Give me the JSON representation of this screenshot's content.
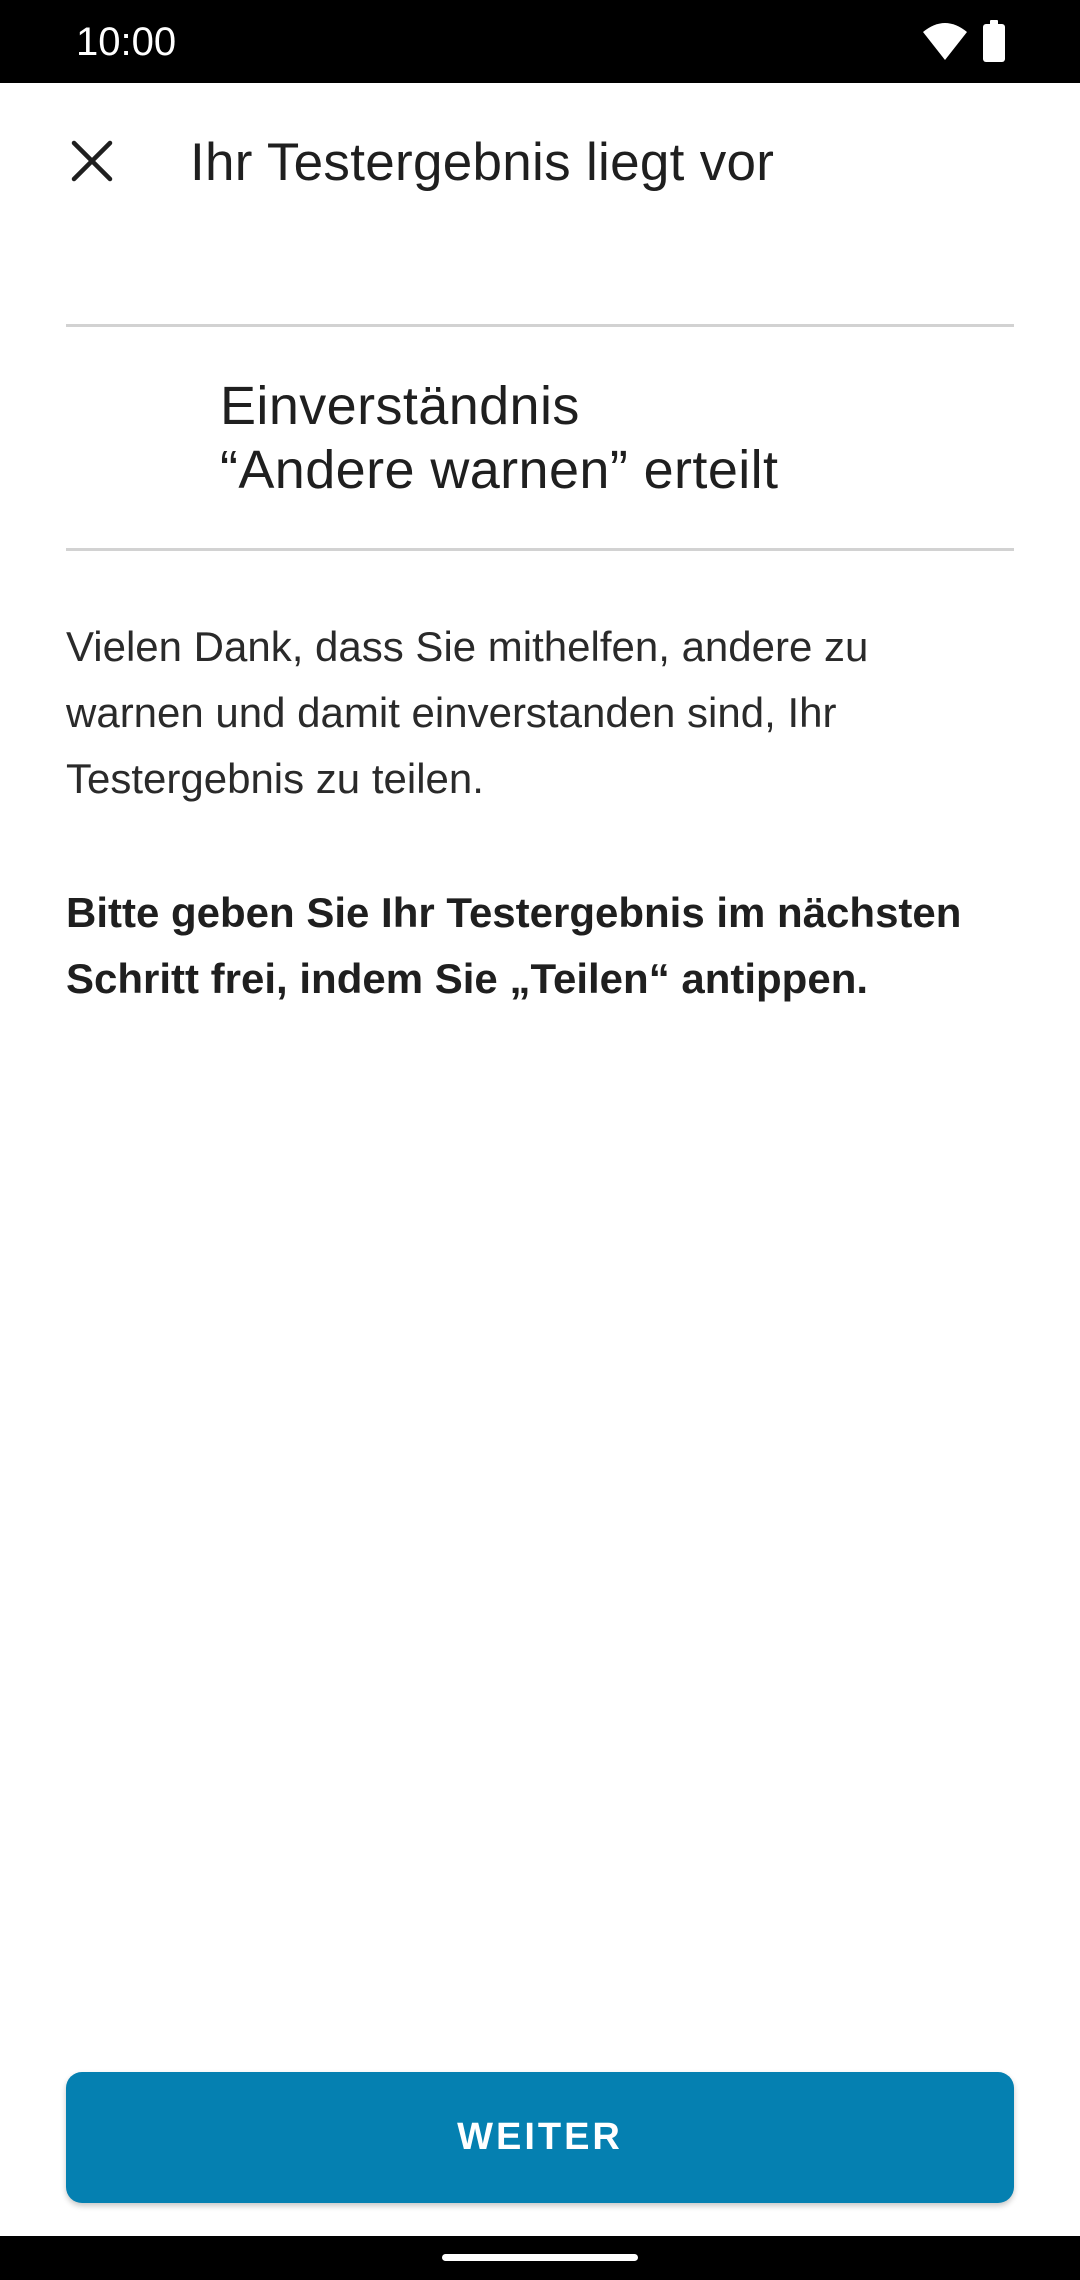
{
  "status_bar": {
    "time": "10:00",
    "icons": [
      "wifi-icon",
      "battery-icon"
    ]
  },
  "app_bar": {
    "close_icon": "close-icon",
    "title": "Ihr Testergebnis liegt vor"
  },
  "headline": {
    "line1": "Einverständnis",
    "line2": "“Andere warnen” erteilt"
  },
  "body": {
    "paragraph": "Vielen Dank, dass Sie mithelfen, andere zu warnen und damit einverstanden sind, Ihr Testergebnis zu teilen.",
    "bold_paragraph": "Bitte geben Sie Ihr Testergebnis im nächsten Schritt frei, indem Sie „Teilen“ antippen."
  },
  "button": {
    "label": "WEITER"
  },
  "colors": {
    "accent": "#0580b1",
    "status_bar": "#000000",
    "divider": "#d2d2d2"
  }
}
